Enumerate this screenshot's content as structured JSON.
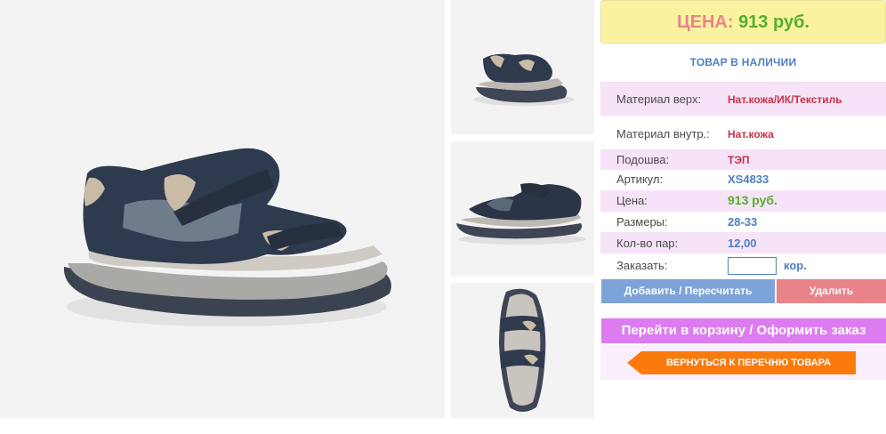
{
  "product": {
    "price_label": "ЦЕНА:",
    "price_value": "913 руб.",
    "stock_status": "ТОВАР В НАЛИЧИИ"
  },
  "specs": {
    "material_top_label": "Материал верх:",
    "material_top_value": "Нат.кожа/ИК/Текстиль",
    "material_inner_label": "Материал внутр.:",
    "material_inner_value": "Нат.кожа",
    "sole_label": "Подошва:",
    "sole_value": "ТЭП",
    "article_label": "Артикул:",
    "article_value": "XS4833",
    "price_label": "Цена:",
    "price_value": "913 руб.",
    "sizes_label": "Размеры:",
    "sizes_value": "28-33",
    "pairs_label": "Кол-во пар:",
    "pairs_value": "12,00",
    "order_label": "Заказать:",
    "order_unit": "кор.",
    "order_quantity": ""
  },
  "actions": {
    "add_label": "Добавить / Пересчитать",
    "delete_label": "Удалить",
    "cart_label": "Перейти в корзину / Оформить заказ",
    "back_label": "ВЕРНУТЬСЯ К ПЕРЕЧНЮ ТОВАРА"
  },
  "colors": {
    "price_box": "#fbf2a0",
    "price_label": "#e8848a",
    "price_value": "#53b02f",
    "link_blue": "#4f80c0",
    "add_button": "#7ea3d8",
    "delete_button": "#e8838a",
    "cart_button": "#dd7cf0",
    "back_button": "#fb7a0c",
    "row_highlight": "#f6e3f7"
  },
  "icons": {
    "back_button": "arrow-left-icon"
  }
}
